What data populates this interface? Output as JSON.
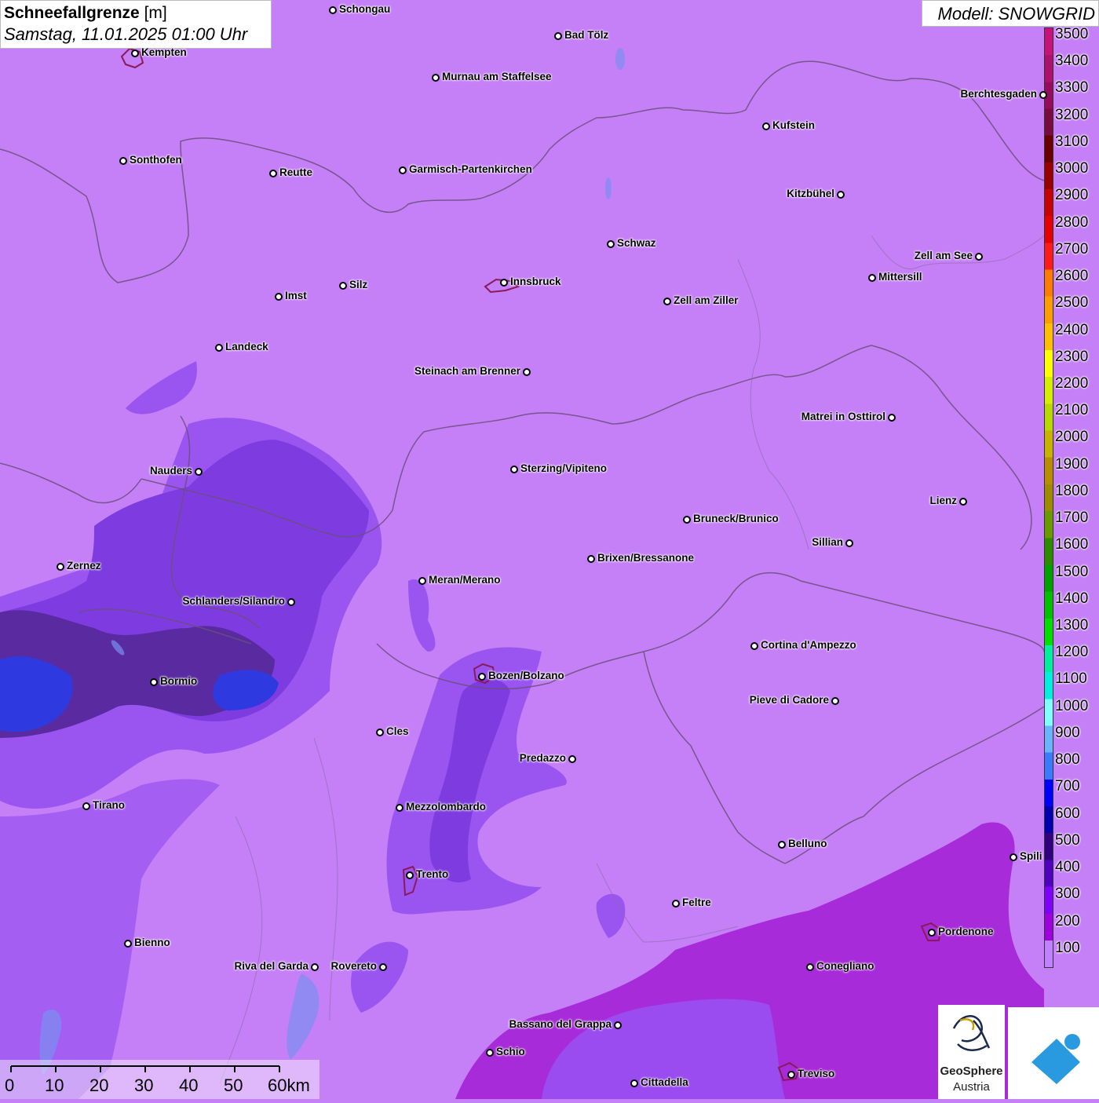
{
  "title": {
    "main_bold": "Schneefallgrenze",
    "unit": " [m]",
    "subtitle": "Samstag, 11.01.2025 01:00 Uhr"
  },
  "model": "Modell: SNOWGRID",
  "legend": {
    "labels": [
      "3500",
      "3400",
      "3300",
      "3200",
      "3100",
      "3000",
      "2900",
      "2800",
      "2700",
      "2600",
      "2500",
      "2400",
      "2300",
      "2200",
      "2100",
      "2000",
      "1900",
      "1800",
      "1700",
      "1600",
      "1500",
      "1400",
      "1300",
      "1200",
      "1100",
      "1000",
      "900",
      "800",
      "700",
      "600",
      "500",
      "400",
      "300",
      "200",
      "100"
    ],
    "colors": [
      "#c8127a",
      "#b0106d",
      "#960a5f",
      "#7a0a40",
      "#6a0000",
      "#9b0000",
      "#c80000",
      "#e60000",
      "#ff1a1a",
      "#ff7a00",
      "#ff9d00",
      "#ffbf00",
      "#ffff00",
      "#d8ee00",
      "#b8d800",
      "#c8b400",
      "#b88e00",
      "#a08a00",
      "#6a9a00",
      "#2e8a00",
      "#00a000",
      "#00c000",
      "#00e000",
      "#00f0a0",
      "#00f0e0",
      "#80ffff",
      "#6ab4ff",
      "#3a7aff",
      "#0000ff",
      "#0000b0",
      "#300080",
      "#5000c0",
      "#8000ff",
      "#a000e0",
      "#c080ff"
    ]
  },
  "cities": [
    {
      "name": "Schongau",
      "side": "r"
    },
    {
      "name": "Bad Tölz",
      "side": "r"
    },
    {
      "name": "Kempten",
      "side": "r"
    },
    {
      "name": "Murnau am Staffelsee",
      "side": "r"
    },
    {
      "name": "Kufstein",
      "side": "r"
    },
    {
      "name": "Berchtesgaden",
      "side": "l"
    },
    {
      "name": "Sonthofen",
      "side": "r"
    },
    {
      "name": "Reutte",
      "side": "r"
    },
    {
      "name": "Garmisch-Partenkirchen",
      "side": "r"
    },
    {
      "name": "Kitzbühel",
      "side": "l"
    },
    {
      "name": "Schwaz",
      "side": "r"
    },
    {
      "name": "Zell am See",
      "side": "l"
    },
    {
      "name": "Mittersill",
      "side": "r"
    },
    {
      "name": "Innsbruck",
      "side": "r"
    },
    {
      "name": "Imst",
      "side": "r"
    },
    {
      "name": "Silz",
      "side": "r"
    },
    {
      "name": "Zell am Ziller",
      "side": "r"
    },
    {
      "name": "Landeck",
      "side": "r"
    },
    {
      "name": "Steinach am Brenner",
      "side": "l"
    },
    {
      "name": "Matrei in Osttirol",
      "side": "l"
    },
    {
      "name": "Nauders",
      "side": "l"
    },
    {
      "name": "Sterzing/Vipiteno",
      "side": "r"
    },
    {
      "name": "Lienz",
      "side": "l"
    },
    {
      "name": "Bruneck/Brunico",
      "side": "r"
    },
    {
      "name": "Sillian",
      "side": "l"
    },
    {
      "name": "Brixen/Bressanone",
      "side": "r"
    },
    {
      "name": "Zernez",
      "side": "r"
    },
    {
      "name": "Meran/Merano",
      "side": "r"
    },
    {
      "name": "Schlanders/Silandro",
      "side": "l"
    },
    {
      "name": "Cortina d'Ampezzo",
      "side": "r"
    },
    {
      "name": "Bozen/Bolzano",
      "side": "r"
    },
    {
      "name": "Bormio",
      "side": "r"
    },
    {
      "name": "Pieve di Cadore",
      "side": "l"
    },
    {
      "name": "Cles",
      "side": "r"
    },
    {
      "name": "Predazzo",
      "side": "l"
    },
    {
      "name": "Tirano",
      "side": "r"
    },
    {
      "name": "Mezzolombardo",
      "side": "r"
    },
    {
      "name": "Belluno",
      "side": "r"
    },
    {
      "name": "Spili",
      "side": "r"
    },
    {
      "name": "Trento",
      "side": "r"
    },
    {
      "name": "Feltre",
      "side": "r"
    },
    {
      "name": "Pordenone",
      "side": "r"
    },
    {
      "name": "Bienno",
      "side": "r"
    },
    {
      "name": "Riva del Garda",
      "side": "l"
    },
    {
      "name": "Rovereto",
      "side": "l"
    },
    {
      "name": "Conegliano",
      "side": "r"
    },
    {
      "name": "Bassano del Grappa",
      "side": "l"
    },
    {
      "name": "Schio",
      "side": "r"
    },
    {
      "name": "Treviso",
      "side": "r"
    },
    {
      "name": "Cittadella",
      "side": "r"
    }
  ],
  "scale": {
    "labels": [
      "0",
      "10",
      "20",
      "30",
      "40",
      "50",
      "60km"
    ]
  },
  "logo": {
    "line1": "GeoSphere",
    "line2": "Austria"
  }
}
